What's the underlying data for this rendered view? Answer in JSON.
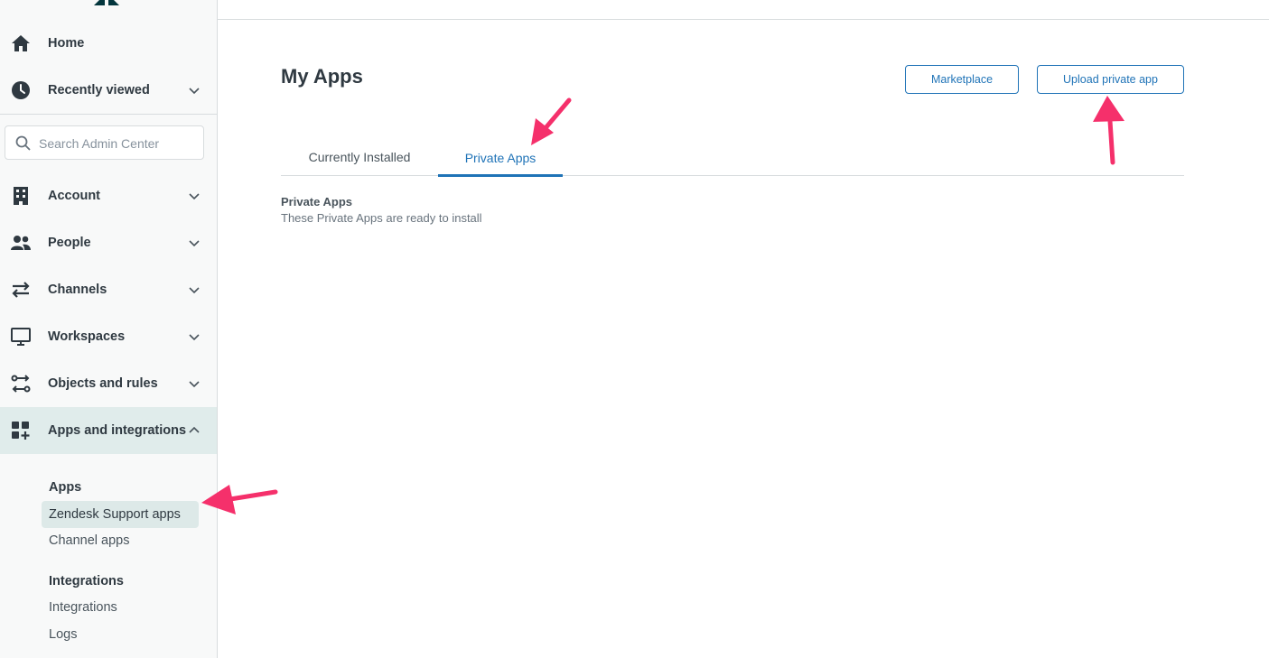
{
  "sidebar": {
    "nav_top": [
      {
        "label": "Home",
        "icon": "home-icon"
      },
      {
        "label": "Recently viewed",
        "icon": "clock-icon"
      }
    ],
    "search": {
      "placeholder": "Search Admin Center",
      "value": ""
    },
    "nav_main": [
      {
        "label": "Account",
        "icon": "building-icon"
      },
      {
        "label": "People",
        "icon": "people-icon"
      },
      {
        "label": "Channels",
        "icon": "arrows-exchange-icon"
      },
      {
        "label": "Workspaces",
        "icon": "monitor-icon"
      },
      {
        "label": "Objects and rules",
        "icon": "objects-rules-icon"
      },
      {
        "label": "Apps and integrations",
        "icon": "apps-grid-icon",
        "expanded": true
      }
    ],
    "apps_section": {
      "heading": "Apps",
      "items": [
        "Zendesk Support apps",
        "Channel apps"
      ],
      "active": "Zendesk Support apps"
    },
    "integrations_section": {
      "heading": "Integrations",
      "items": [
        "Integrations",
        "Logs"
      ]
    }
  },
  "main": {
    "title": "My Apps",
    "buttons": {
      "marketplace": "Marketplace",
      "upload": "Upload private app"
    },
    "tabs": [
      {
        "label": "Currently Installed",
        "selected": false
      },
      {
        "label": "Private Apps",
        "selected": true
      }
    ],
    "section": {
      "title": "Private Apps",
      "description": "These Private Apps are ready to install"
    }
  },
  "colors": {
    "accent": "#1f73b7",
    "sidebar_bg": "#f8f9f9",
    "active_bg": "#e0eceb",
    "annotation_arrow": "#f5306b"
  }
}
